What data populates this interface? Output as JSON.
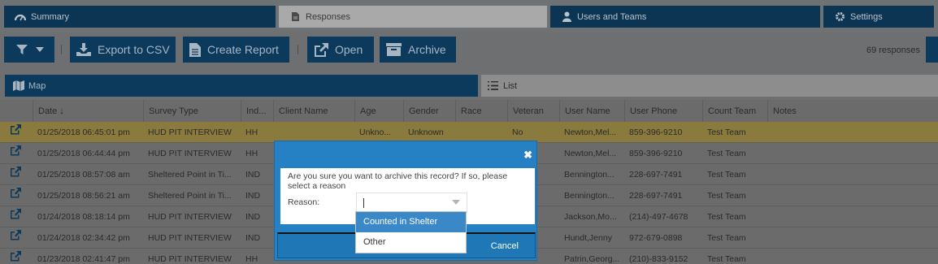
{
  "tabs": [
    {
      "label": "Summary",
      "icon": "dashboard-icon"
    },
    {
      "label": "Responses",
      "icon": "document-icon"
    },
    {
      "label": "Users and Teams",
      "icon": "user-icon"
    },
    {
      "label": "Settings",
      "icon": "gear-icon"
    }
  ],
  "toolbar": {
    "export_label": "Export to CSV",
    "report_label": "Create Report",
    "open_label": "Open",
    "archive_label": "Archive",
    "response_count": "69 responses"
  },
  "views": {
    "map_label": "Map",
    "list_label": "List"
  },
  "table": {
    "columns": [
      "Date ↓",
      "Survey Type",
      "Ind...",
      "Client Name",
      "Age",
      "Gender",
      "Race",
      "Veteran",
      "User Name",
      "User Phone",
      "Count Team",
      "Notes"
    ],
    "rows": [
      {
        "date": "01/25/2018 06:45:01 pm",
        "survey": "HUD PIT INTERVIEW",
        "ind": "HH",
        "client": "",
        "age": "Unkno...",
        "gender": "Unknown",
        "race": "",
        "veteran": "No",
        "user": "Newton,Mel...",
        "phone": "859-396-9210",
        "team": "Test Team"
      },
      {
        "date": "01/25/2018 06:44:44 pm",
        "survey": "HUD PIT INTERVIEW",
        "ind": "HH",
        "client": "",
        "age": "",
        "gender": "",
        "race": "",
        "veteran": "",
        "user": "Newton,Mel...",
        "phone": "859-396-9210",
        "team": "Test Team"
      },
      {
        "date": "01/25/2018 08:57:08 am",
        "survey": "Sheltered Point in Ti...",
        "ind": "IND",
        "client": "",
        "age": "",
        "gender": "",
        "race": "",
        "veteran": "",
        "user": "Bennington...",
        "phone": "228-697-7491",
        "team": "Test Team"
      },
      {
        "date": "01/25/2018 08:56:21 am",
        "survey": "Sheltered Point in Ti...",
        "ind": "IND",
        "client": "",
        "age": "",
        "gender": "",
        "race": "",
        "veteran": "",
        "user": "Bennington...",
        "phone": "228-697-7491",
        "team": "Test Team"
      },
      {
        "date": "01/24/2018 08:18:14 pm",
        "survey": "HUD PIT INTERVIEW",
        "ind": "IND",
        "client": "",
        "age": "",
        "gender": "",
        "race": "",
        "veteran": "",
        "user": "Jackson,Mo...",
        "phone": "(214)-497-4678",
        "team": "Test Team"
      },
      {
        "date": "01/24/2018 02:34:42 pm",
        "survey": "HUD PIT INTERVIEW",
        "ind": "IND",
        "client": "",
        "age": "",
        "gender": "",
        "race": "",
        "veteran": "",
        "user": "Hundt,Jenny",
        "phone": "972-679-0898",
        "team": "Test Team"
      },
      {
        "date": "01/23/2018 02:41:47 pm",
        "survey": "HUD PIT INTERVIEW",
        "ind": "HH",
        "client": "",
        "age": "",
        "gender": "",
        "race": "",
        "veteran": "",
        "user": "Patrin,Georg...",
        "phone": "(210)-833-9152",
        "team": "Test Team"
      }
    ]
  },
  "modal": {
    "message": "Are you sure you want to archive this record? If so, please select a reason",
    "reason_label": "Reason:",
    "cancel_label": "Cancel",
    "options": [
      "Counted in Shelter",
      "Other"
    ]
  },
  "colors": {
    "accent": "#2581c4",
    "nav": "#0c3a5d",
    "highlight_row": "#8a7a3d"
  }
}
